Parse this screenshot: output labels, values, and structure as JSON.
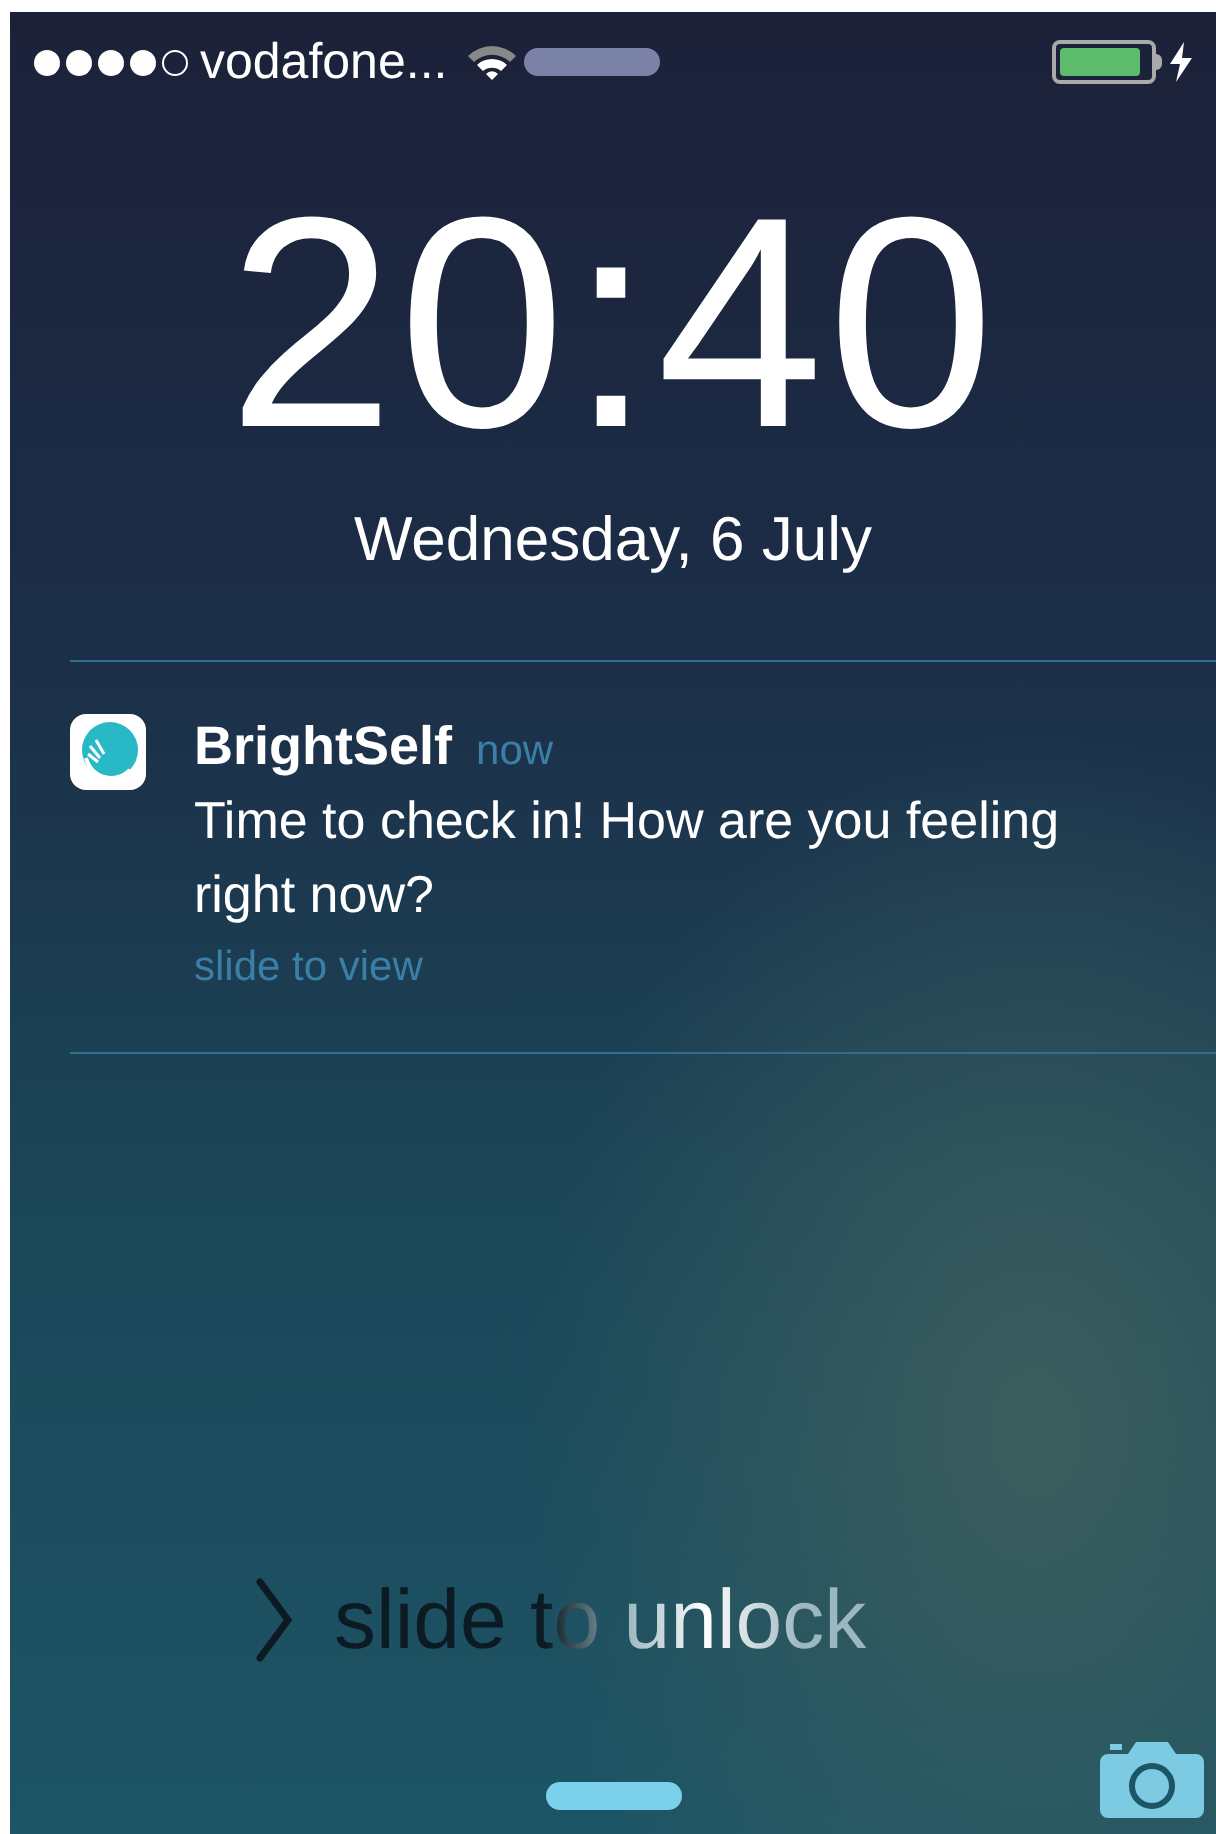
{
  "status_bar": {
    "signal": [
      {
        "filled": true
      },
      {
        "filled": true
      },
      {
        "filled": true
      },
      {
        "filled": true
      },
      {
        "filled": false
      }
    ],
    "carrier": "vodafone...",
    "charging": true
  },
  "lock_screen": {
    "time": "20:40",
    "date": "Wednesday, 6 July"
  },
  "notifications": [
    {
      "app": "BrightSelf",
      "time": "now",
      "message": "Time to check in! How are you feeling right now?",
      "action": "slide to view"
    }
  ],
  "unlock": {
    "label": "slide to unlock"
  }
}
